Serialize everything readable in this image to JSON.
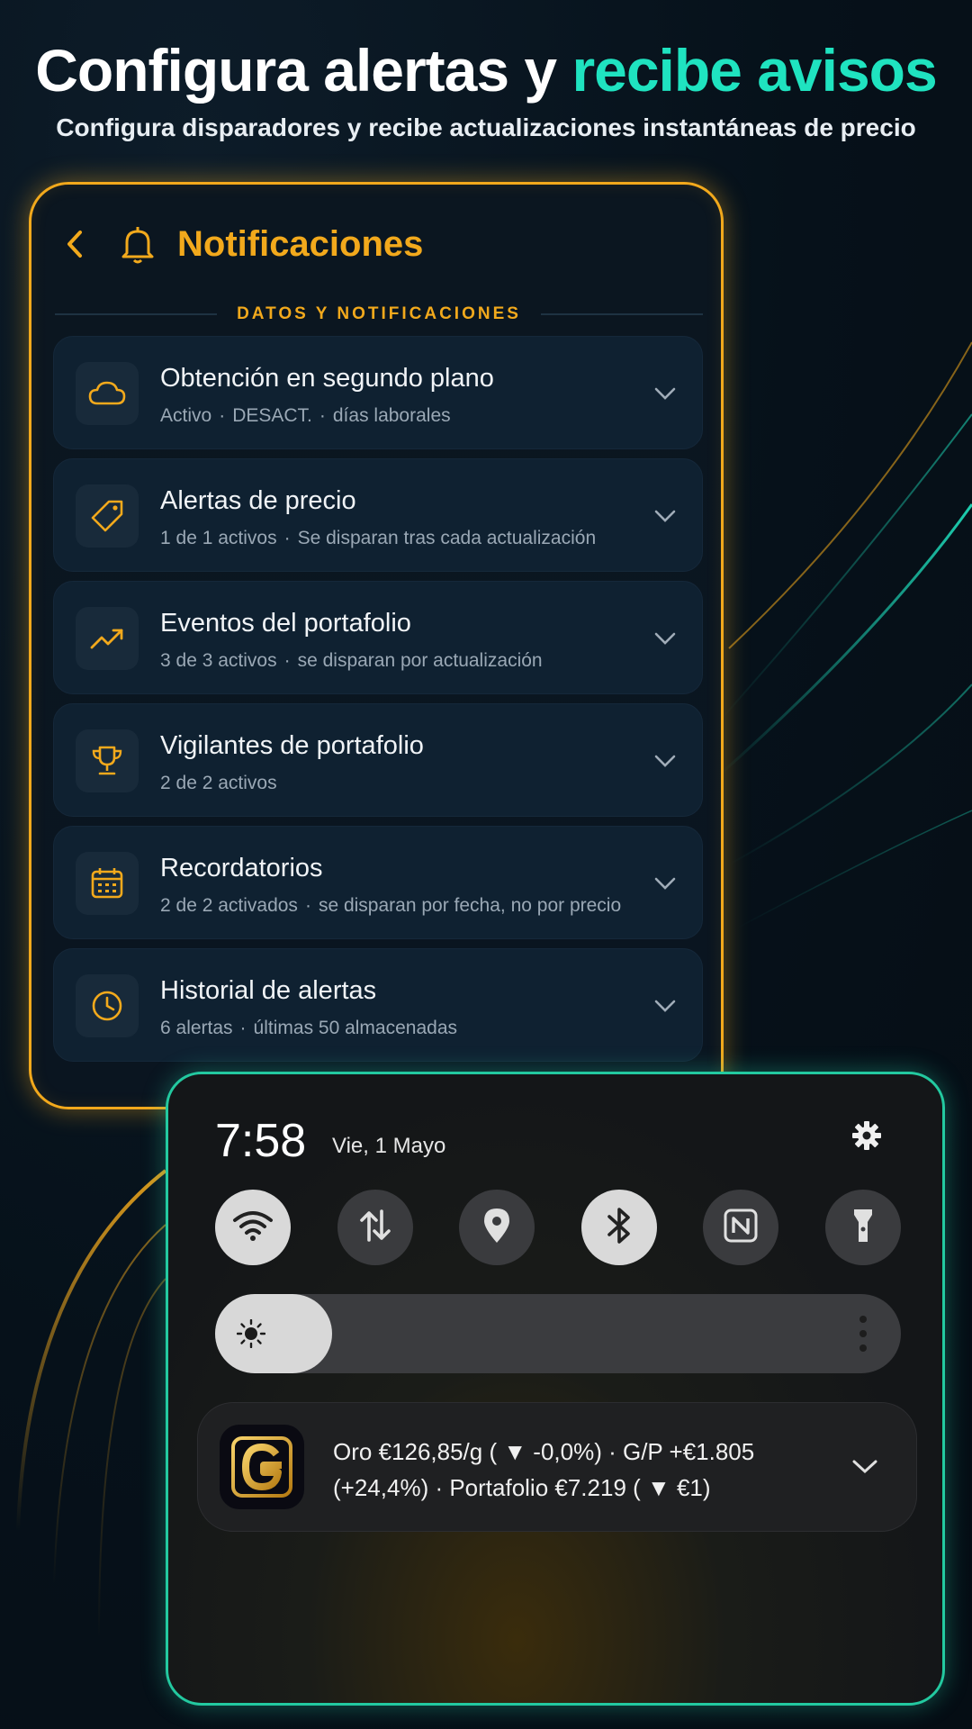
{
  "hero": {
    "title_main": "Configura alertas y ",
    "title_accent": "recibe avisos",
    "subtitle": "Configura disparadores y recibe actualizaciones instantáneas de precio",
    "accent_color": "#1fe3c0"
  },
  "notifications_panel": {
    "title": "Notificaciones",
    "section_label": "DATOS Y NOTIFICACIONES",
    "accent_color": "#f2a91c",
    "items": [
      {
        "icon": "cloud-icon",
        "title": "Obtención en segundo plano",
        "sub1": "Activo",
        "sub2": "DESACT.",
        "sub3": "días laborales"
      },
      {
        "icon": "tag-icon",
        "title": "Alertas de precio",
        "sub1": "1 de 1 activos",
        "sub2": "Se disparan tras cada actualización",
        "sub3": ""
      },
      {
        "icon": "trending-up-icon",
        "title": "Eventos del portafolio",
        "sub1": "3 de 3 activos",
        "sub2": "se disparan por actualización",
        "sub3": ""
      },
      {
        "icon": "trophy-icon",
        "title": "Vigilantes de portafolio",
        "sub1": "2 de 2 activos",
        "sub2": "",
        "sub3": ""
      },
      {
        "icon": "calendar-icon",
        "title": "Recordatorios",
        "sub1": "2 de 2 activados",
        "sub2": "se disparan por fecha, no por precio",
        "sub3": ""
      },
      {
        "icon": "clock-icon",
        "title": "Historial de alertas",
        "sub1": "6 alertas",
        "sub2": "últimas 50 almacenadas",
        "sub3": ""
      }
    ]
  },
  "quick_settings": {
    "time": "7:58",
    "date": "Vie, 1 Mayo",
    "tiles": [
      {
        "icon": "wifi-icon",
        "active": true
      },
      {
        "icon": "data-transfer-icon",
        "active": false
      },
      {
        "icon": "location-icon",
        "active": false
      },
      {
        "icon": "bluetooth-icon",
        "active": true
      },
      {
        "icon": "nfc-icon",
        "active": false
      },
      {
        "icon": "flashlight-icon",
        "active": false
      }
    ],
    "brightness_level": 0.17,
    "notification": {
      "app_icon": "gold-g-logo",
      "line1": "Oro €126,85/g ( ▼ -0,0%) · G/P +€1.805",
      "line2": "(+24,4%) · Portafolio €7.219 ( ▼ €1)"
    },
    "accent_color": "#23c9a0"
  }
}
